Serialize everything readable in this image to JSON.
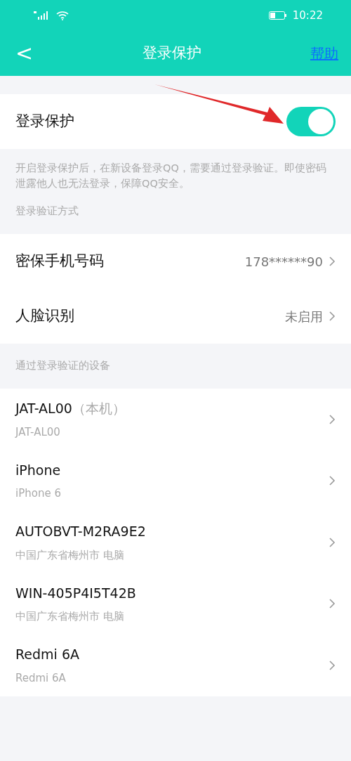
{
  "status_bar": {
    "time": "10:22"
  },
  "header": {
    "back": "<",
    "title": "登录保护",
    "action": "帮助"
  },
  "protection": {
    "label": "登录保护",
    "on": true
  },
  "description": "开启登录保护后，在新设备登录QQ，需要通过登录验证。即使密码泄露他人也无法登录，保障QQ安全。",
  "methods_heading": "登录验证方式",
  "methods": [
    {
      "label": "密保手机号码",
      "value": "178******90"
    },
    {
      "label": "人脸识别",
      "value": "未启用"
    }
  ],
  "devices_heading": "通过登录验证的设备",
  "devices": [
    {
      "name": "JAT-AL00",
      "tag": "（本机）",
      "detail": "JAT-AL00"
    },
    {
      "name": "iPhone",
      "detail": "iPhone 6"
    },
    {
      "name": "AUTOBVT-M2RA9E2",
      "detail": "中国广东省梅州市 电脑"
    },
    {
      "name": "WIN-405P4I5T42B",
      "detail": "中国广东省梅州市 电脑"
    },
    {
      "name": "Redmi 6A",
      "detail": "Redmi 6A"
    }
  ]
}
